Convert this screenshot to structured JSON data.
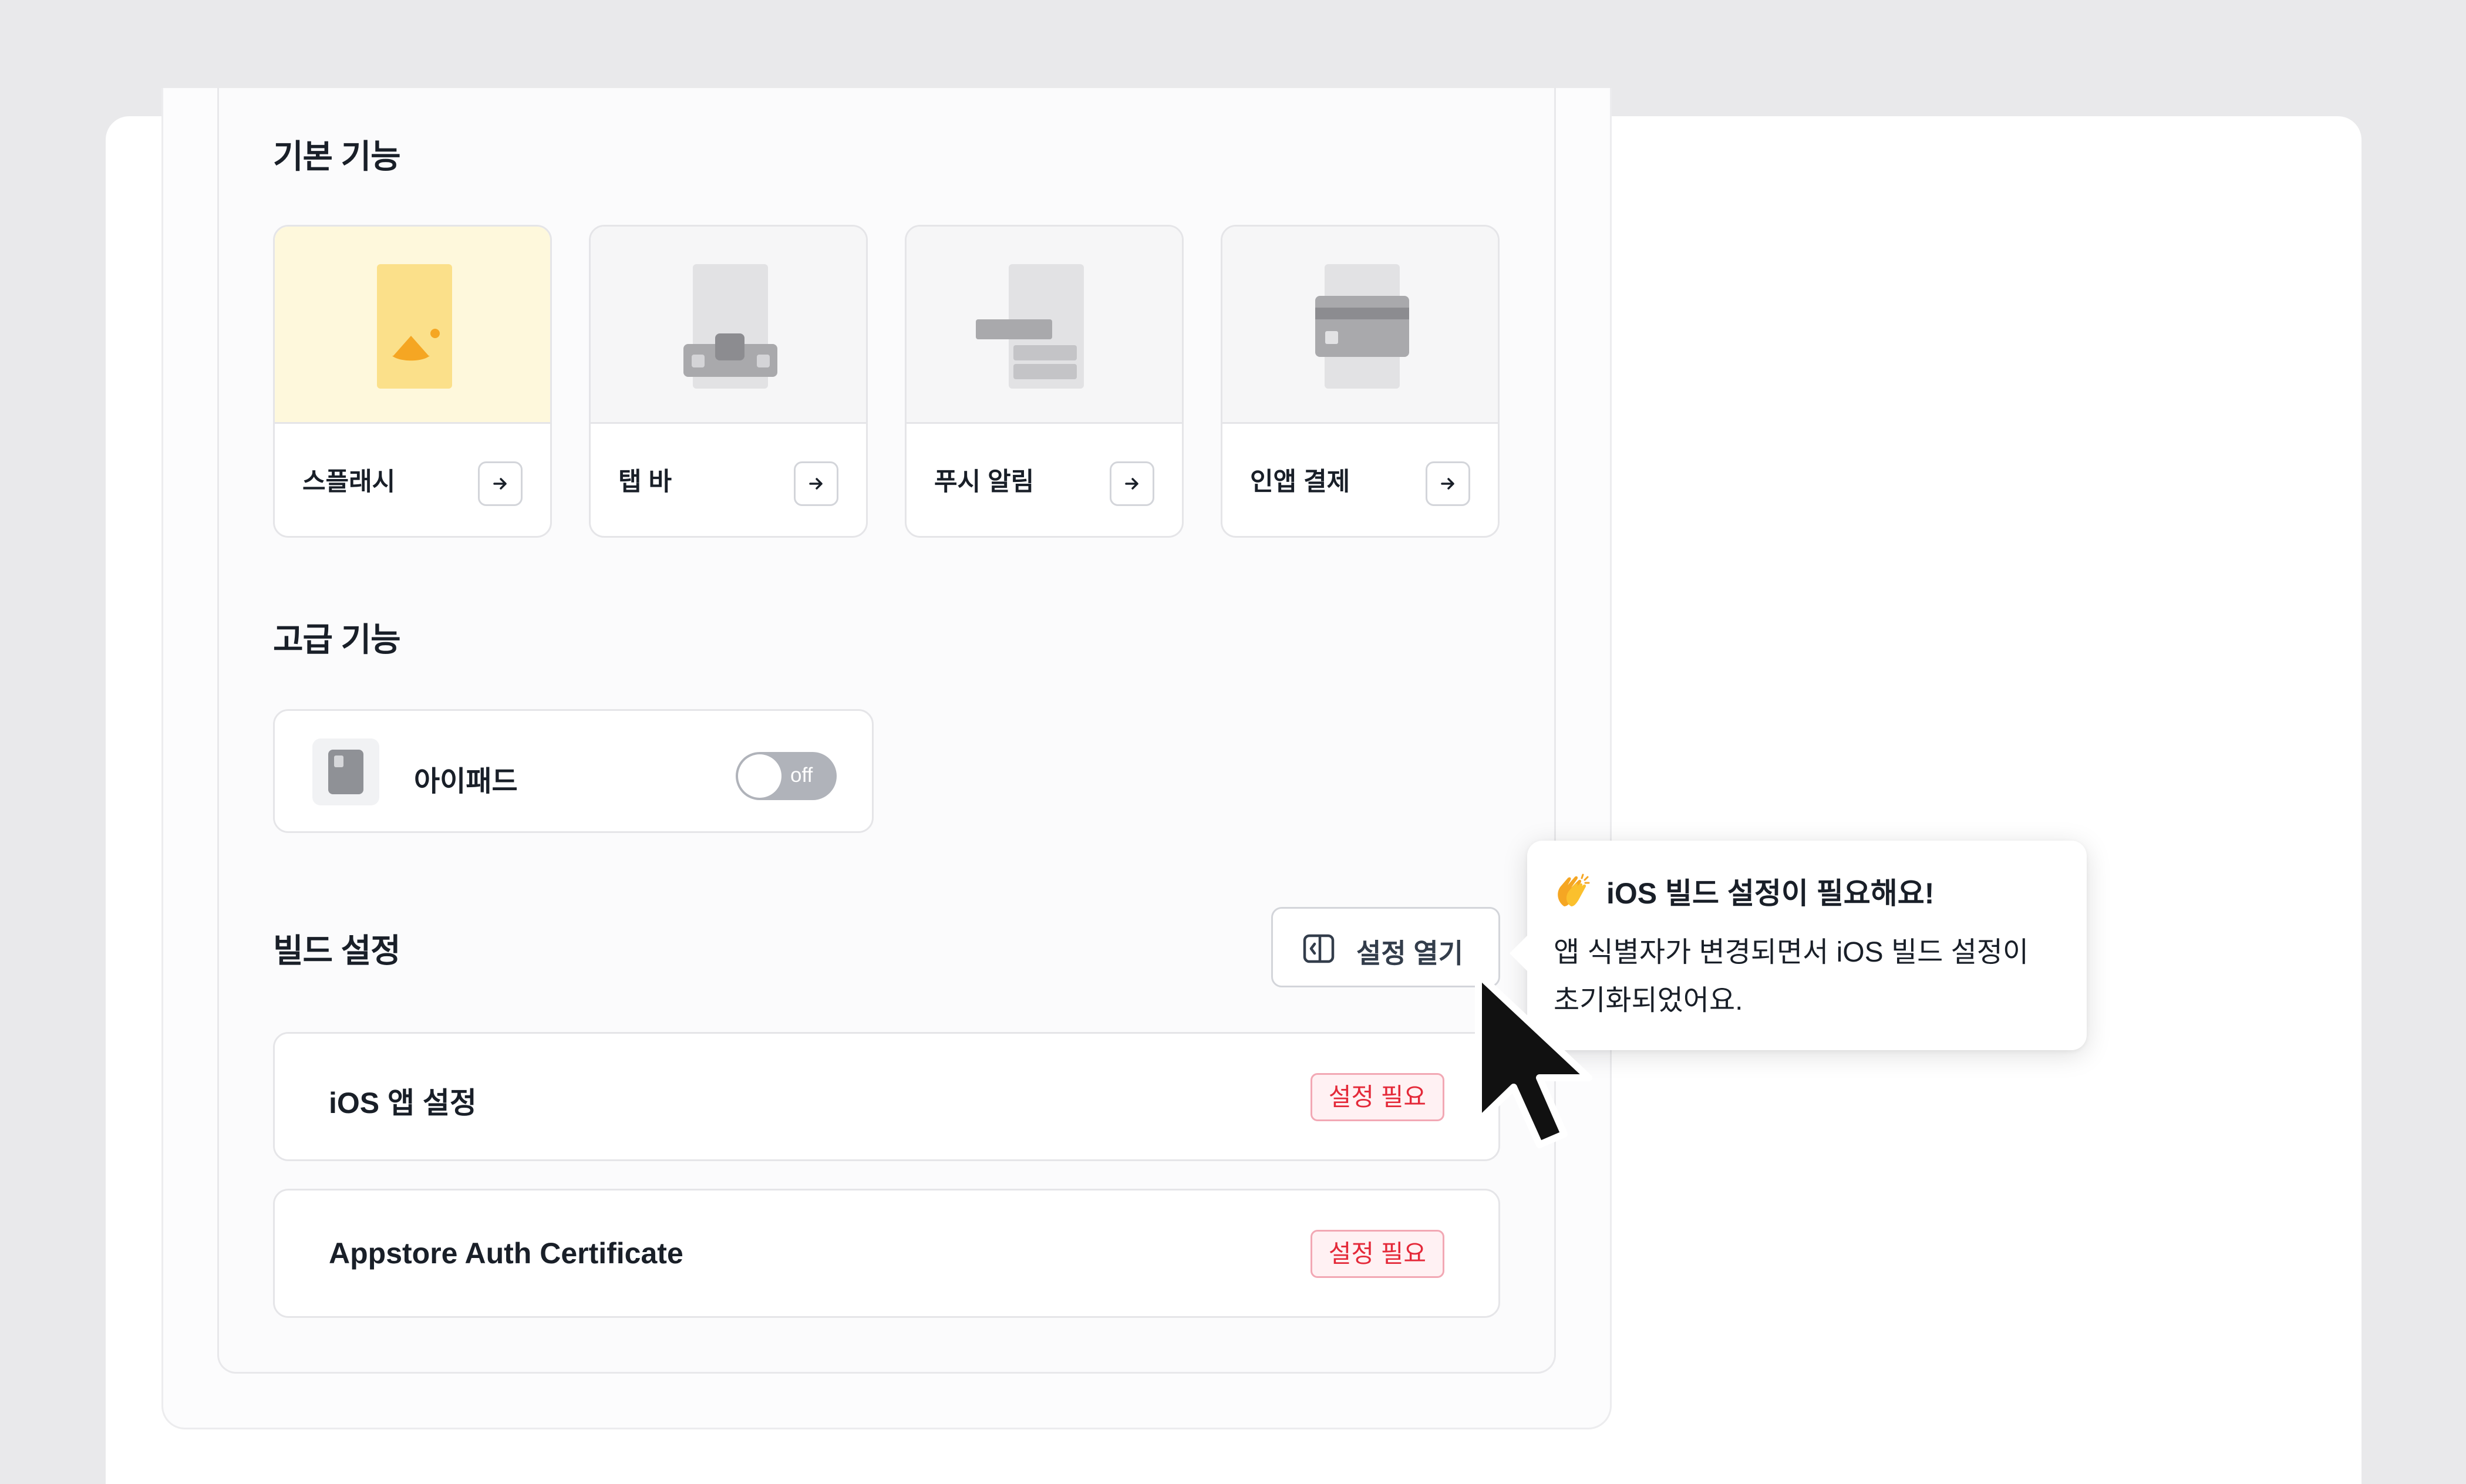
{
  "sections": {
    "basic": "기본 기능",
    "advanced": "고급 기능",
    "build": "빌드 설정"
  },
  "features": [
    {
      "label": "스플래시",
      "icon": "splash-icon",
      "active": true
    },
    {
      "label": "탭 바",
      "icon": "tab-bar-icon",
      "active": false
    },
    {
      "label": "푸시 알림",
      "icon": "push-notification-icon",
      "active": false
    },
    {
      "label": "인앱 결제",
      "icon": "in-app-payment-icon",
      "active": false
    }
  ],
  "advanced": {
    "ipad": {
      "label": "아이패드",
      "toggle_text": "off",
      "enabled": false
    }
  },
  "build": {
    "open_button": "설정 열기",
    "rows": [
      {
        "label": "iOS 앱 설정",
        "badge": "설정 필요"
      },
      {
        "label": "Appstore Auth Certificate",
        "badge": "설정 필요"
      }
    ]
  },
  "tooltip": {
    "emoji": "clapping-hands-icon",
    "title": "iOS 빌드 설정이 필요해요!",
    "line1": "앱 식별자가 변경되면서 iOS 빌드 설정이",
    "line2": "초기화되었어요."
  },
  "colors": {
    "accent_yellow": "#fef8dc",
    "splash_orange": "#f5a623",
    "badge_red": "#e42939",
    "toggle_off": "#b0b3ba"
  }
}
